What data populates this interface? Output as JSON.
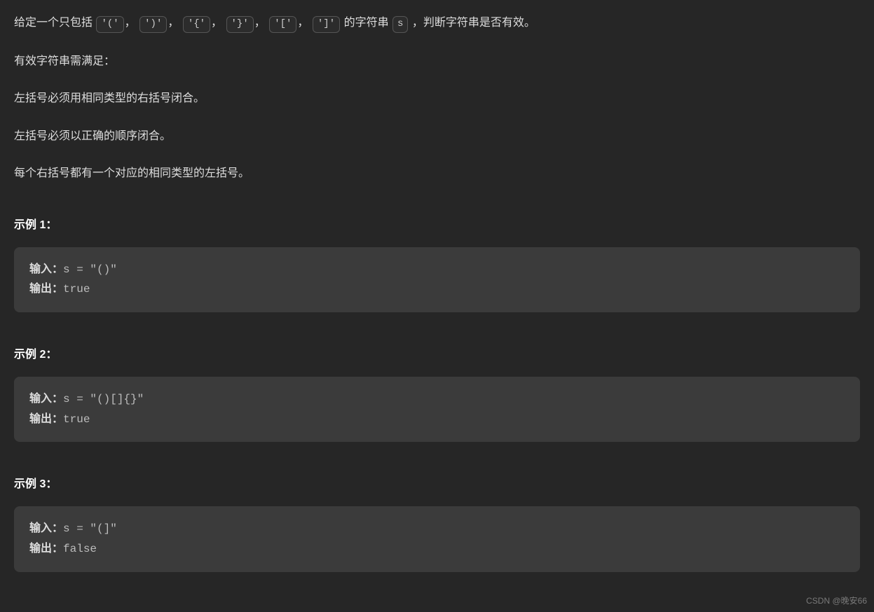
{
  "desc": {
    "line1_prefix": "给定一个只包括 ",
    "codes": [
      "'('",
      "')'",
      "'{'",
      "'}'",
      "'['",
      "']'"
    ],
    "comma": "，",
    "line1_mid": " 的字符串 ",
    "var_s": "s",
    "line1_suffix": " ，判断字符串是否有效。",
    "line2": "有效字符串需满足：",
    "rule1": "左括号必须用相同类型的右括号闭合。",
    "rule2": "左括号必须以正确的顺序闭合。",
    "rule3": "每个右括号都有一个对应的相同类型的左括号。"
  },
  "labels": {
    "input": "输入：",
    "output": "输出："
  },
  "examples": [
    {
      "title": "示例 1：",
      "input": "s = \"()\"",
      "output": "true"
    },
    {
      "title": "示例 2：",
      "input": "s = \"()[]{}\"",
      "output": "true"
    },
    {
      "title": "示例 3：",
      "input": "s = \"(]\"",
      "output": "false"
    }
  ],
  "watermark": "CSDN @晚安66"
}
